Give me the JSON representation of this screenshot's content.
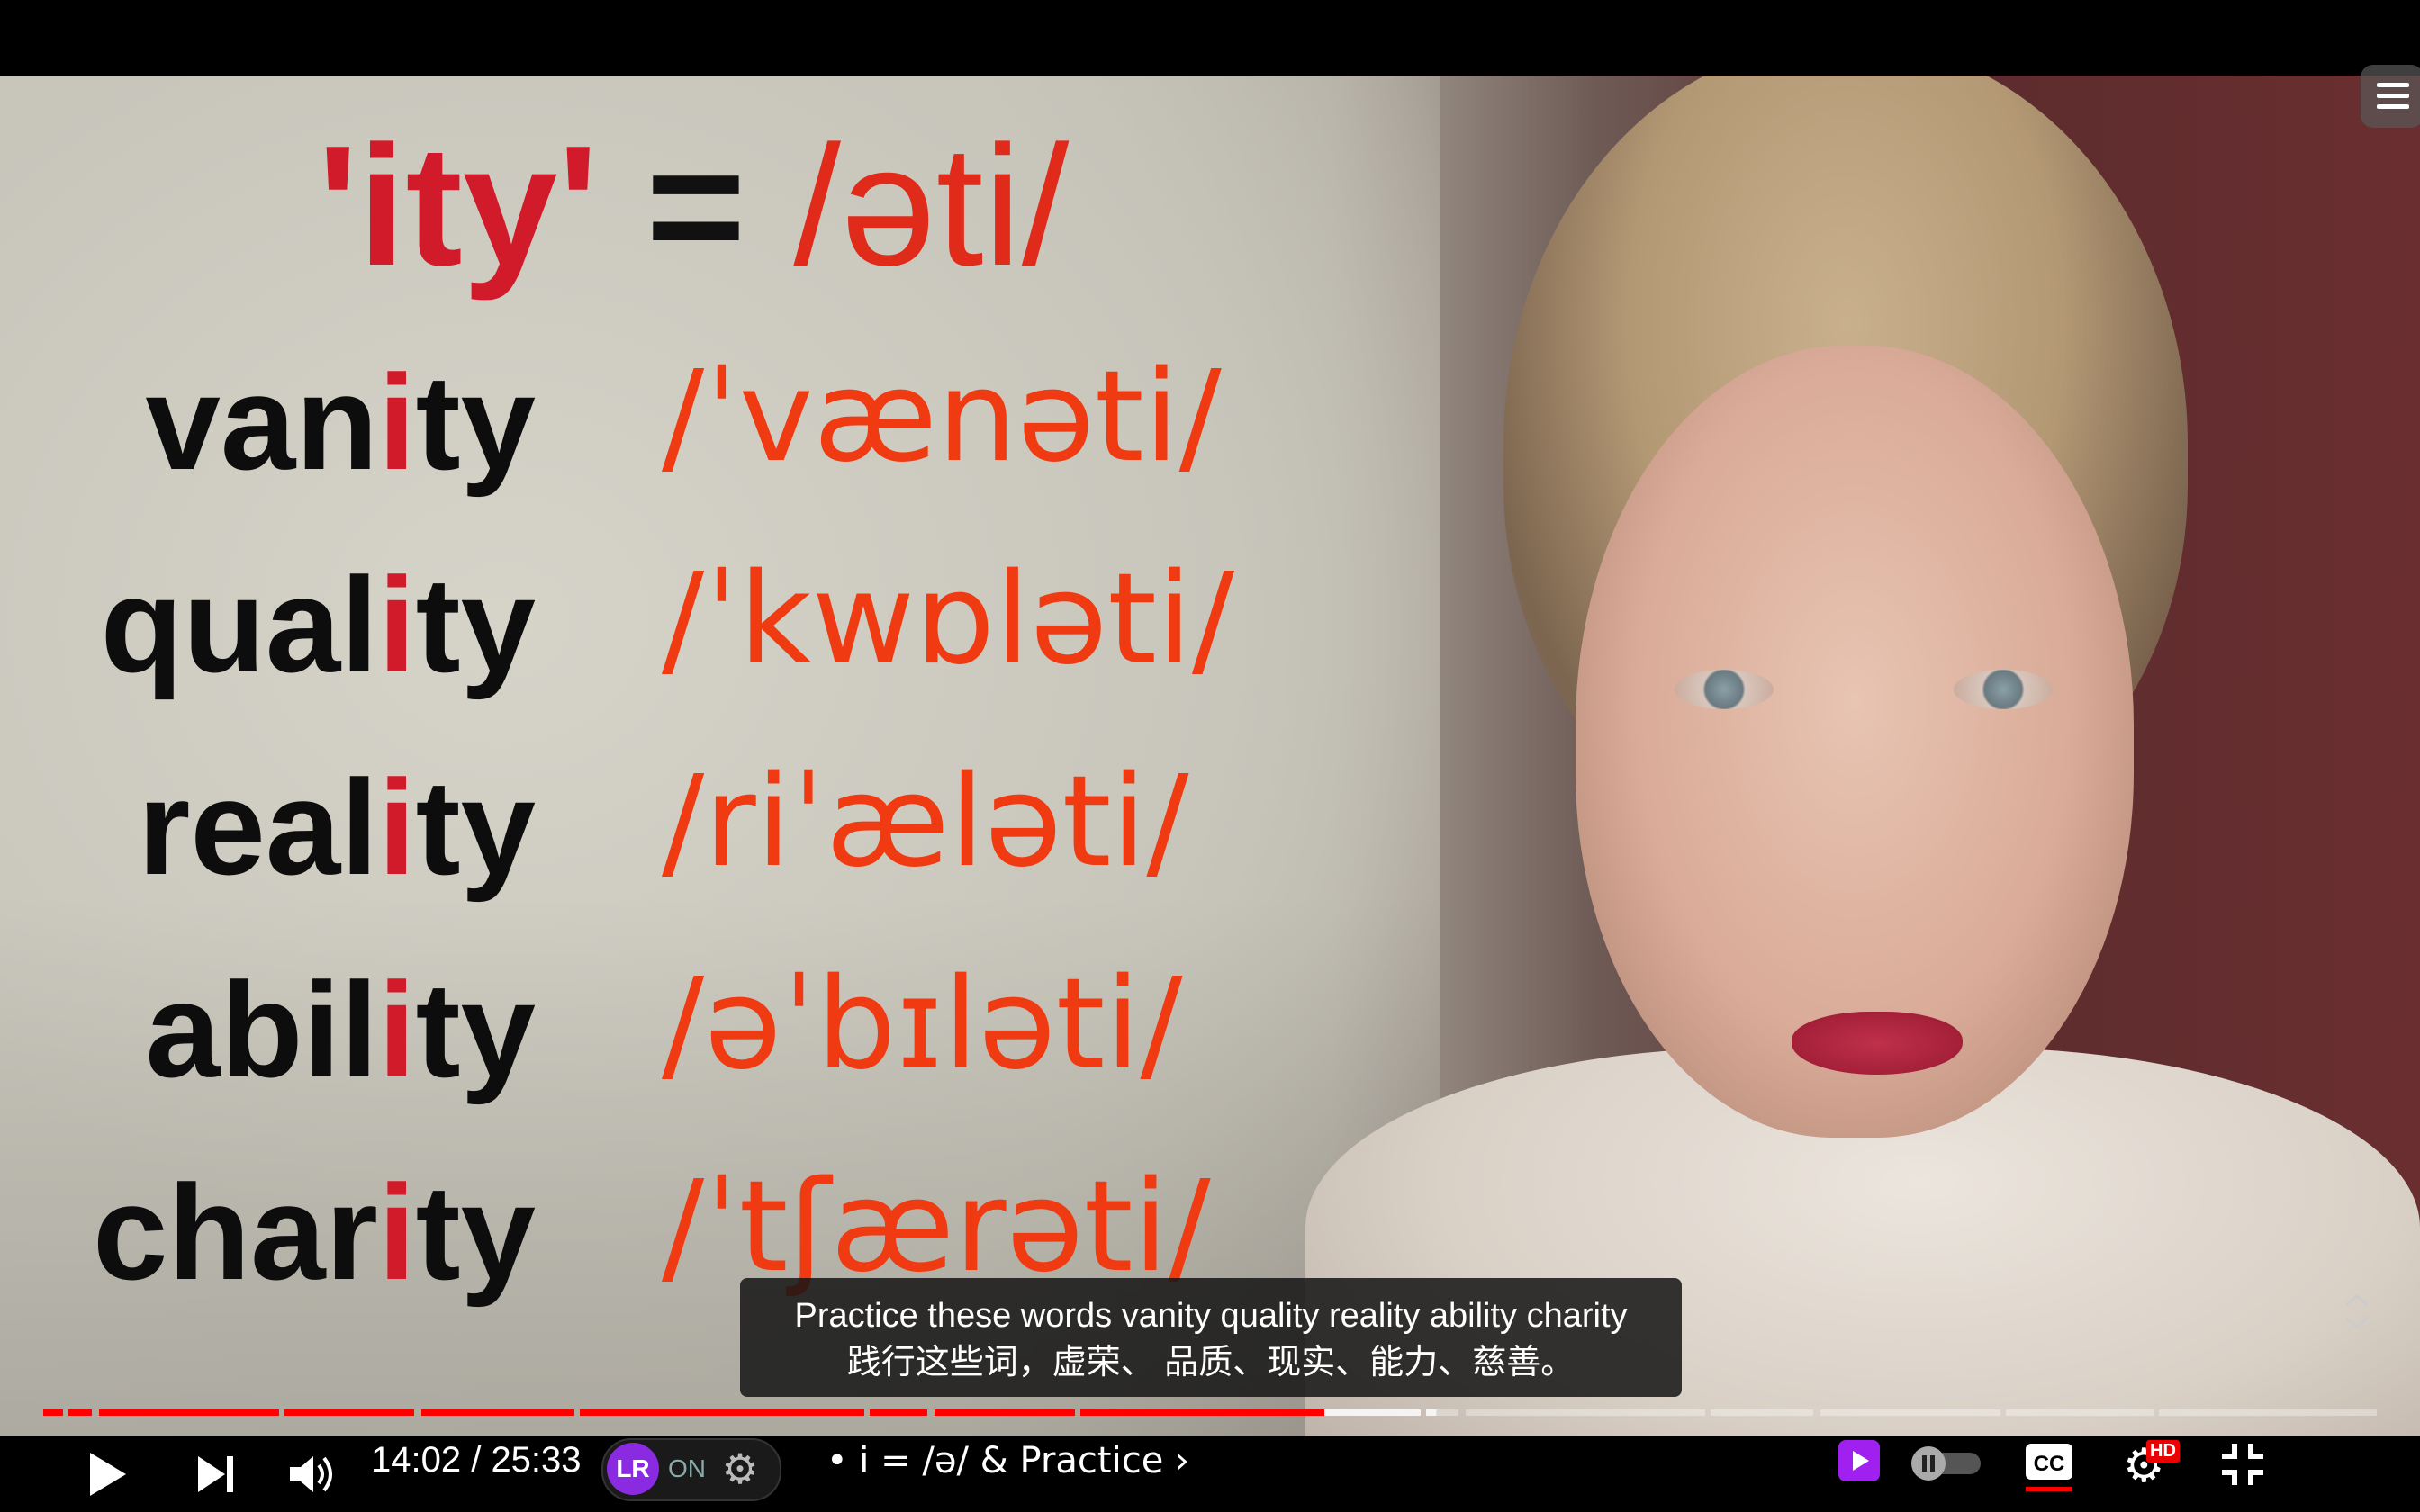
{
  "slide": {
    "title_left": "'ity'",
    "title_eq": " = ",
    "title_ipa": "/əti/",
    "rows": [
      {
        "pre": "van",
        "hl": "i",
        "post": "ty",
        "ipa": "/ˈvænəti/"
      },
      {
        "pre": "qual",
        "hl": "i",
        "post": "ty",
        "ipa": "/ˈkwɒləti/"
      },
      {
        "pre": "real",
        "hl": "i",
        "post": "ty",
        "ipa": "/riˈæləti/"
      },
      {
        "pre": "abil",
        "hl": "i",
        "post": "ty",
        "ipa": "/əˈbɪləti/"
      },
      {
        "pre": "char",
        "hl": "i",
        "post": "ty",
        "ipa": "/ˈtʃærəti/"
      }
    ]
  },
  "captions": {
    "line1": "Practice these words vanity quality reality ability charity",
    "line2": "践行这些词，虚荣、 品质、现实、能力、慈善。"
  },
  "player": {
    "time_display": "14:02 / 25:33",
    "chapter": "• i = /ə/ & Practice",
    "chapter_arrow": "›",
    "lr_label": "LR",
    "lr_status": "ON",
    "hd_badge": "HD",
    "cc_label": "CC",
    "progress_fraction": 0.549,
    "buffered_fraction": 0.597,
    "accent_color": "#ff0000"
  },
  "icons": [
    "play-icon",
    "next-icon",
    "volume-icon",
    "settings-icon",
    "cc-icon",
    "autoplay-toggle-icon",
    "miniplayer-icon",
    "exit-fullscreen-icon",
    "menu-icon",
    "expand-icon"
  ]
}
